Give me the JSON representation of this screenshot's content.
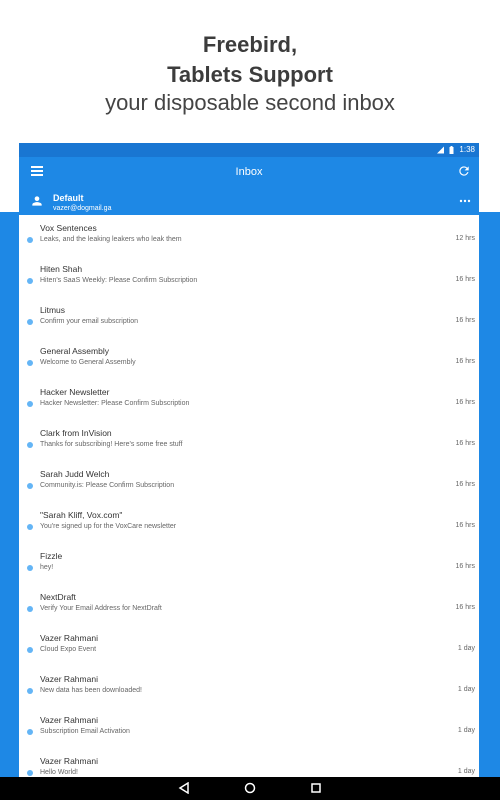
{
  "promo": {
    "line1": "Freebird,",
    "line2": "Tablets Support",
    "line3": "your disposable second inbox"
  },
  "status_bar": {
    "time": "1:38"
  },
  "toolbar": {
    "title": "Inbox",
    "menu_icon": "hamburger-menu-icon",
    "refresh_icon": "refresh-icon"
  },
  "account": {
    "name": "Default",
    "email": "vazer@dogmail.ga",
    "more_icon": "more-horizontal-icon"
  },
  "messages": [
    {
      "sender": "Vox Sentences",
      "subject": "Leaks, and the leaking leakers who leak them",
      "time": "12 hrs"
    },
    {
      "sender": "Hiten Shah",
      "subject": "Hiten's SaaS Weekly: Please Confirm Subscription",
      "time": "16 hrs"
    },
    {
      "sender": "Litmus",
      "subject": "Confirm your email subscription",
      "time": "16 hrs"
    },
    {
      "sender": "General Assembly",
      "subject": "Welcome to General Assembly",
      "time": "16 hrs"
    },
    {
      "sender": "Hacker Newsletter",
      "subject": "Hacker Newsletter: Please Confirm Subscription",
      "time": "16 hrs"
    },
    {
      "sender": "Clark from InVision",
      "subject": "Thanks for subscribing! Here's some free stuff",
      "time": "16 hrs"
    },
    {
      "sender": "Sarah Judd Welch",
      "subject": "Community.is: Please Confirm Subscription",
      "time": "16 hrs"
    },
    {
      "sender": "\"Sarah Kliff, Vox.com\"",
      "subject": "You're signed up for the VoxCare newsletter",
      "time": "16 hrs"
    },
    {
      "sender": "Fizzle",
      "subject": "hey!",
      "time": "16 hrs"
    },
    {
      "sender": "NextDraft",
      "subject": "Verify Your Email Address for NextDraft",
      "time": "16 hrs"
    },
    {
      "sender": "Vazer Rahmani",
      "subject": "Cloud Expo Event",
      "time": "1 day"
    },
    {
      "sender": "Vazer Rahmani",
      "subject": "New data has been downloaded!",
      "time": "1 day"
    },
    {
      "sender": "Vazer Rahmani",
      "subject": "Subscription Email Activation",
      "time": "1 day"
    },
    {
      "sender": "Vazer Rahmani",
      "subject": "Hello World!",
      "time": "1 day"
    }
  ],
  "nav_bar": {
    "back_icon": "back-triangle-icon",
    "home_icon": "home-circle-icon",
    "recents_icon": "recents-square-icon"
  },
  "colors": {
    "primary": "#1e88e5",
    "primary_dark": "#1976d2",
    "unread_dot": "#64b5f6"
  }
}
